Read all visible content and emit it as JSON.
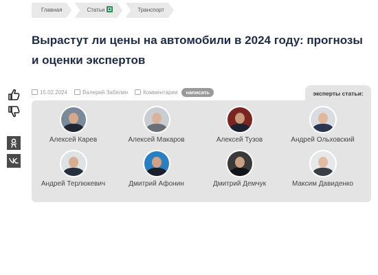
{
  "breadcrumb": {
    "items": [
      {
        "label": "Главная"
      },
      {
        "label": "Статьи"
      },
      {
        "label": "Транспорт"
      }
    ]
  },
  "article": {
    "title": "Вырастут ли цены на автомобили в 2024 году: прогнозы и оценки экспертов",
    "date": "15.02.2024",
    "author": "Валерий Забелин",
    "comments_label": "Комментарии",
    "write_button": "написать"
  },
  "social": {
    "ok_label": "ok",
    "vk_label": "vk"
  },
  "experts": {
    "tab_label": "эксперты статьи:",
    "list": [
      {
        "name": "Алексей Карев",
        "bg": "#7a8a9a",
        "skin": "#d7a98c",
        "suit": "#1f2733"
      },
      {
        "name": "Алексей Макаров",
        "bg": "#c9ccd0",
        "skin": "#d8b39b",
        "suit": "#6b6f75"
      },
      {
        "name": "Алексей Тузов",
        "bg": "#7a2520",
        "skin": "#c99a7e",
        "suit": "#1d2230"
      },
      {
        "name": "Андрей Ольховский",
        "bg": "#d9dde2",
        "skin": "#e0b79c",
        "suit": "#2c3550"
      },
      {
        "name": "Андрей Терлюкевич",
        "bg": "#dfe2e5",
        "skin": "#d8ae92",
        "suit": "#27303f"
      },
      {
        "name": "Дмитрий Афонин",
        "bg": "#2b7fc0",
        "skin": "#cfa185",
        "suit": "#1a1f2b"
      },
      {
        "name": "Дмитрий Демчук",
        "bg": "#3a3a3a",
        "skin": "#caa083",
        "suit": "#111418"
      },
      {
        "name": "Максим Давиденко",
        "bg": "#e6e8ea",
        "skin": "#e2bda3",
        "suit": "#3a3f47"
      }
    ]
  }
}
